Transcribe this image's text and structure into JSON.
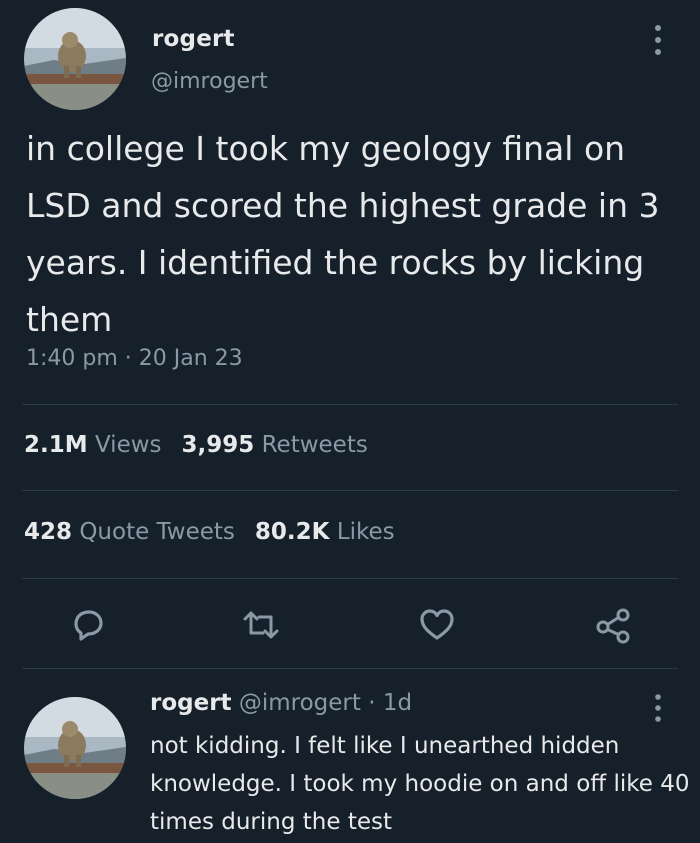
{
  "tweet": {
    "author_name": "rogert",
    "author_handle": "@imrogert",
    "text": "in college I took my geology final on LSD and scored the highest grade in 3 years. I identified the rocks by licking them",
    "timestamp": "1:40 pm · 20 Jan 23",
    "more_icon": "more-vertical-icon"
  },
  "stats": {
    "views_count": "2.1M",
    "views_label": "Views",
    "retweets_count": "3,995",
    "retweets_label": "Retweets",
    "quotes_count": "428",
    "quotes_label": "Quote Tweets",
    "likes_count": "80.2K",
    "likes_label": "Likes"
  },
  "actions": {
    "reply_icon": "reply-icon",
    "retweet_icon": "retweet-icon",
    "like_icon": "heart-icon",
    "share_icon": "share-icon"
  },
  "reply": {
    "author_name": "rogert",
    "meta": " @imrogert · 1d",
    "text": "not kidding. I felt like I unearthed hidden knowledge. I took my hoodie on and off like 40 times during the test",
    "more_icon": "more-vertical-icon"
  },
  "colors": {
    "background": "#15202b",
    "text_primary": "#e7e9ea",
    "text_secondary": "#8b98a5",
    "divider": "#2f3b47"
  }
}
